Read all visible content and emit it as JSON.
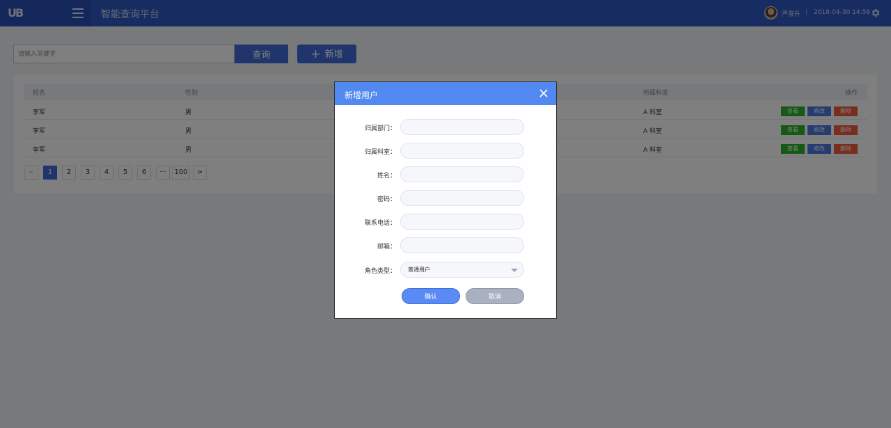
{
  "header": {
    "logo": "UB",
    "title": "智能查询平台",
    "user_name": "严景升",
    "separator": "|",
    "datetime": "2018-04-30 14:56"
  },
  "search": {
    "placeholder": "请输入关键字",
    "search_label": "查询",
    "add_label": "新增",
    "add_icon": "+"
  },
  "table": {
    "columns": {
      "name": "姓名",
      "gender": "性别",
      "dept": "所属科室",
      "ops": "操作"
    },
    "rows": [
      {
        "name": "李军",
        "gender": "男",
        "dept": "A 科室"
      },
      {
        "name": "李军",
        "gender": "男",
        "dept": "A 科室"
      },
      {
        "name": "李军",
        "gender": "男",
        "dept": "A 科室"
      }
    ],
    "actions": {
      "view": "查看",
      "edit": "修改",
      "delete": "删除"
    }
  },
  "pagination": {
    "prev": "<",
    "pages": [
      "1",
      "2",
      "3",
      "4",
      "5",
      "6"
    ],
    "ellipsis": "···",
    "last": "100",
    "next": ">",
    "current": "1"
  },
  "modal": {
    "title": "新增用户",
    "close": "×",
    "fields": {
      "dept": "归属部门：",
      "office": "归属科室：",
      "name": "姓名：",
      "password": "密码：",
      "phone": "联系电话：",
      "email": "邮箱：",
      "role": "角色类型："
    },
    "role_value": "普通用户",
    "confirm_label": "确认",
    "cancel_label": "取消"
  },
  "colors": {
    "header": "#2f59c3",
    "primary": "#3e6ad9",
    "modal_header": "#5289f0",
    "view": "#2bb32b",
    "edit": "#4a78e0",
    "delete": "#f05a3c"
  }
}
